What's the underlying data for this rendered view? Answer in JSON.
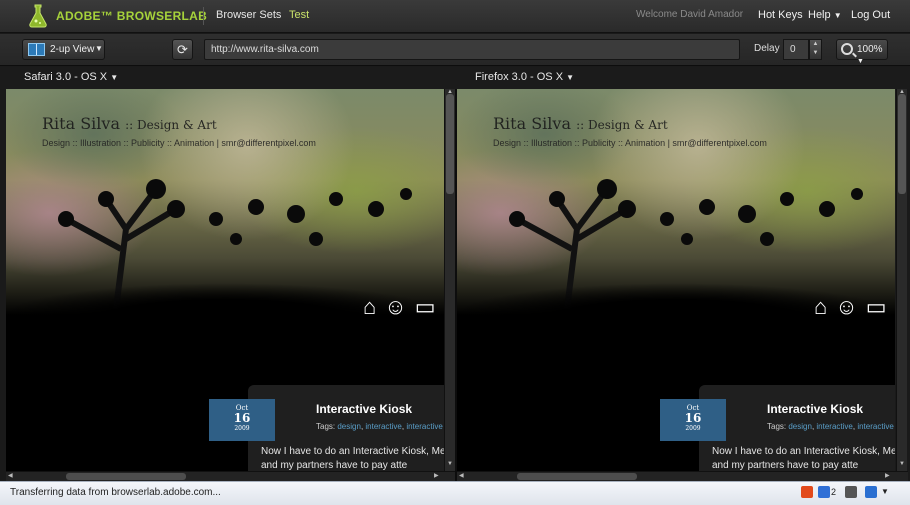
{
  "app": {
    "brand": "ADOBE",
    "brand_suffix": "BROWSERLAB",
    "nav": {
      "browser_sets": "Browser Sets",
      "test": "Test"
    },
    "welcome": "Welcome David Amador",
    "hot_keys": "Hot Keys",
    "help": "Help",
    "logout": "Log Out"
  },
  "toolbar": {
    "view_label": "2-up View",
    "url": "http://www.rita-silva.com",
    "delay_label": "Delay",
    "delay_value": "0",
    "zoom": "100%"
  },
  "browsers": {
    "left": "Safari 3.0 - OS X",
    "right": "Firefox 3.0 - OS X"
  },
  "site": {
    "title": "Rita Silva",
    "title_suffix": ":: Design & Art",
    "subtitle": "Design :: Illustration :: Publicity :: Animation | smr@differentpixel.com",
    "post": {
      "month": "Oct",
      "day": "16",
      "year": "2009",
      "title": "Interactive Kiosk",
      "tags_label": "Tags:",
      "tags": [
        "design",
        "interactive",
        "interactive"
      ],
      "body": "Now I have to do an Interactive Kiosk, Me and my partners have to pay atte"
    }
  },
  "status": {
    "text": "Transferring data from browserlab.adobe.com...",
    "count": "2"
  },
  "colors": {
    "accent": "#a6d23b",
    "date_box": "#2f5f86",
    "tag_link": "#5a9ec8"
  }
}
